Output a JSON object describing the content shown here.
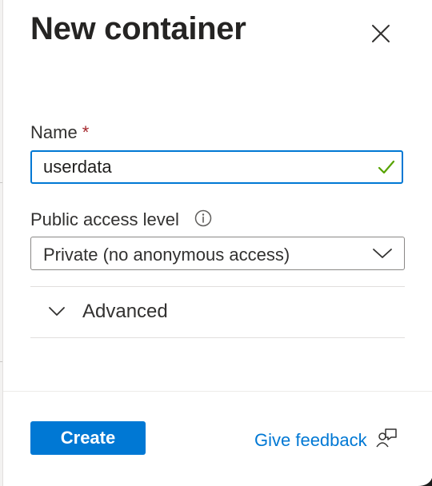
{
  "panel": {
    "title": "New container"
  },
  "name_field": {
    "label": "Name",
    "required_marker": "*",
    "value": "userdata",
    "valid": true
  },
  "access_field": {
    "label": "Public access level",
    "selected": "Private (no anonymous access)"
  },
  "advanced": {
    "label": "Advanced",
    "expanded": false
  },
  "footer": {
    "create_label": "Create",
    "feedback_label": "Give feedback"
  },
  "colors": {
    "accent": "#0078d4",
    "required": "#a4262c",
    "valid_check": "#57a300"
  },
  "icons": {
    "close": "close-icon",
    "valid": "checkmark-icon",
    "info": "info-icon",
    "dropdown": "chevron-down-icon",
    "expander": "chevron-down-icon",
    "feedback": "feedback-person-icon"
  }
}
